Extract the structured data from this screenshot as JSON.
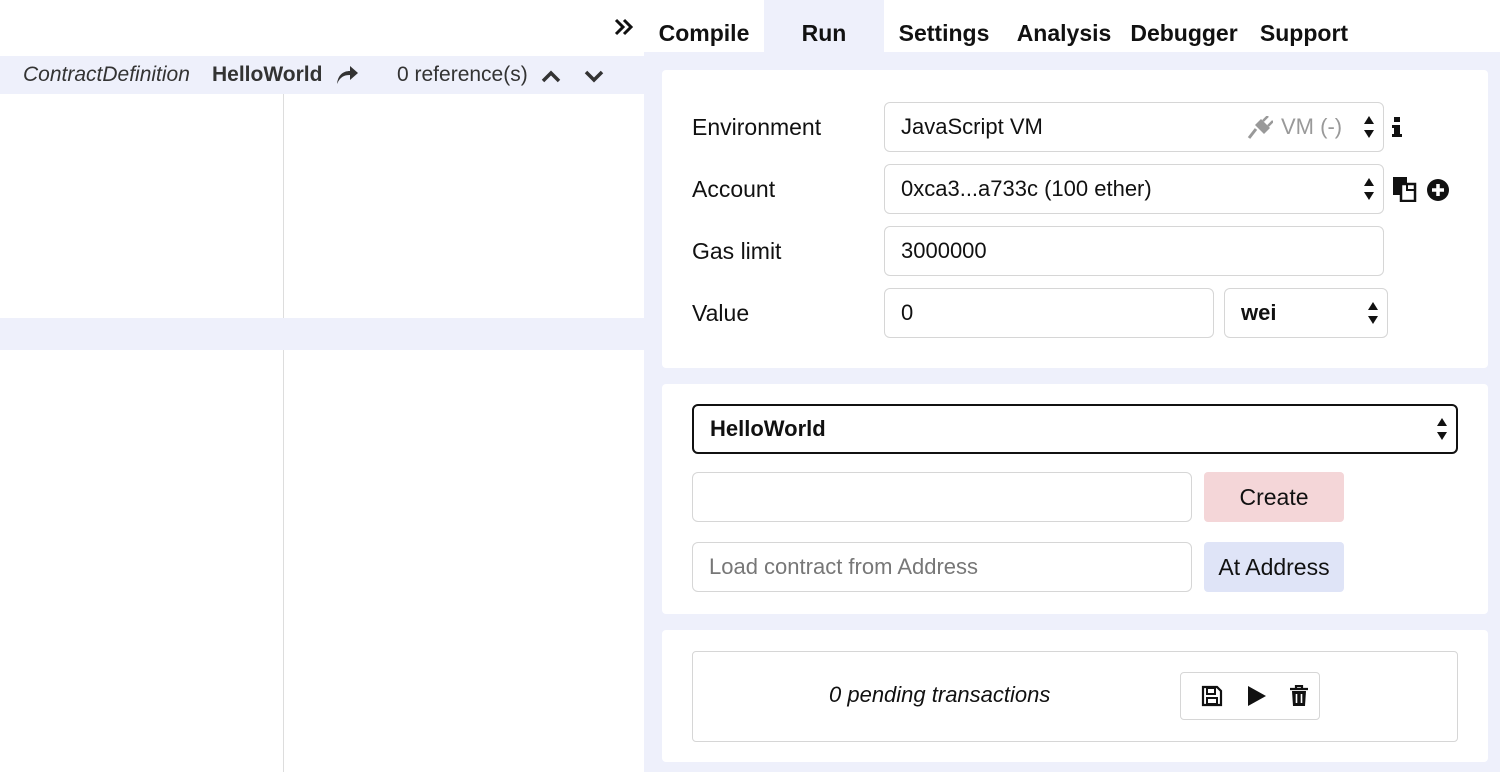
{
  "tabs": [
    "Compile",
    "Run",
    "Settings",
    "Analysis",
    "Debugger",
    "Support"
  ],
  "active_tab": "Run",
  "editor": {
    "context_type": "ContractDefinition",
    "context_name": "HelloWorld",
    "references": "0 reference(s)"
  },
  "run": {
    "environment_label": "Environment",
    "environment_value": "JavaScript VM",
    "environment_badge": "VM (-)",
    "account_label": "Account",
    "account_value": "0xca3...a733c (100 ether)",
    "gas_limit_label": "Gas limit",
    "gas_limit_value": "3000000",
    "value_label": "Value",
    "value_value": "0",
    "value_unit": "wei",
    "contract_select": "HelloWorld",
    "create_args_value": "",
    "create_button": "Create",
    "load_placeholder": "Load contract from Address",
    "at_address_button": "At Address",
    "pending": "0 pending transactions"
  },
  "colors": {
    "panel_bg": "#eef0fb",
    "create_btn": "#f4d6d8",
    "at_address_btn": "#dfe4f7"
  },
  "icons": [
    "collapse-icon",
    "jump-to-definition-icon",
    "chevron-up-icon",
    "chevron-down-icon",
    "plug-icon",
    "info-icon",
    "copy-icon",
    "plus-circle-icon",
    "save-icon",
    "play-icon",
    "trash-icon"
  ]
}
